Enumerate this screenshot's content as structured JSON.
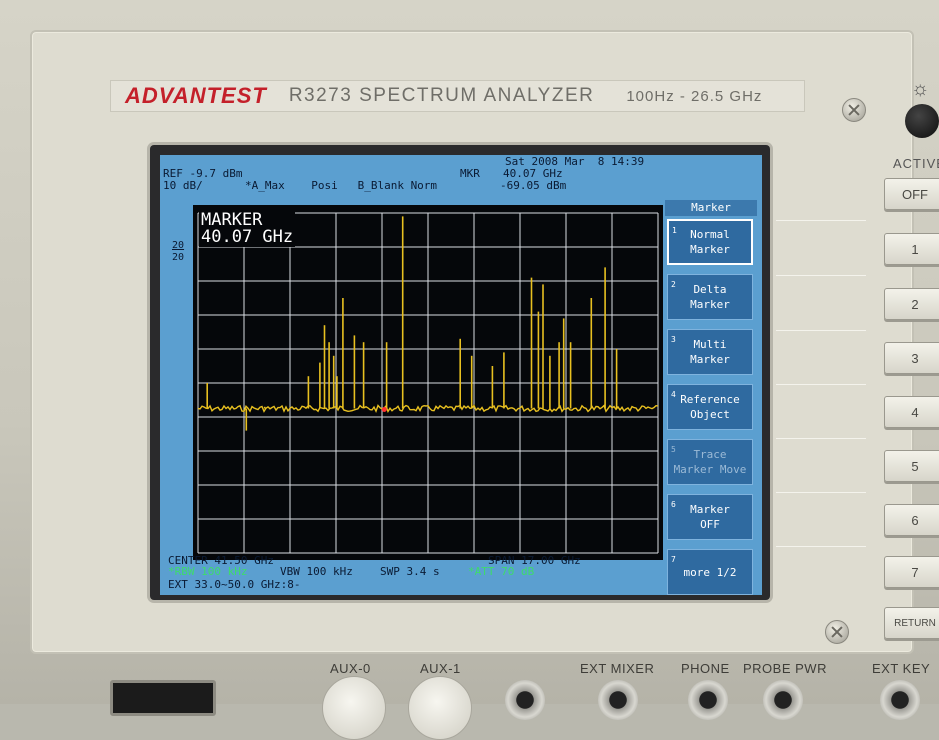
{
  "instrument": {
    "brand": "ADVANTEST",
    "model": "R3273  SPECTRUM  ANALYZER",
    "freq_range": "100Hz - 26.5 GHz"
  },
  "screen": {
    "datetime": "Sat 2008 Mar  8 14:39",
    "ref": "REF -9.7 dBm",
    "scale": "10 dB/",
    "trace_modes": "*A_Max    Posi   B_Blank Norm",
    "mkr_label": "MKR",
    "mkr_freq": "40.07 GHz",
    "mkr_level": "-69.05 dBm",
    "left_mark_top": "20",
    "left_mark_bottom": "20",
    "marker_readout_line1": "MARKER",
    "marker_readout_line2": "40.07 GHz",
    "center": "CENTER 41.50 GHz",
    "span": "SPAN 17.00 GHz",
    "rbw": "*RBW 100 kHz",
    "vbw": "VBW 100 kHz",
    "swp": "SWP 3.4 s",
    "att": "*ATT 70 dB",
    "ext": "EXT 33.0~50.0 GHz:8-"
  },
  "softkeys": {
    "title": "Marker",
    "keys": [
      {
        "num": "1",
        "line1": "Normal",
        "line2": "Marker"
      },
      {
        "num": "2",
        "line1": "Delta",
        "line2": "Marker"
      },
      {
        "num": "3",
        "line1": "Multi",
        "line2": "Marker"
      },
      {
        "num": "4",
        "line1": "Reference",
        "line2": "Object"
      },
      {
        "num": "5",
        "line1": "Trace",
        "line2": "Marker Move"
      },
      {
        "num": "6",
        "line1": "Marker",
        "line2": "OFF"
      },
      {
        "num": "7",
        "line1": "more 1/2",
        "line2": ""
      }
    ]
  },
  "side_buttons": {
    "active_label": "ACTIVE",
    "off": "OFF",
    "b1": "1",
    "b2": "2",
    "b3": "3",
    "b4": "4",
    "b5": "5",
    "b6": "6",
    "b7": "7",
    "return": "RETURN"
  },
  "bottom_labels": {
    "aux0": "AUX-0",
    "aux1": "AUX-1",
    "ext_mixer": "EXT MIXER",
    "phone": "PHONE",
    "probe_pwr": "PROBE PWR",
    "ext_key": "EXT KEY"
  },
  "trace": {
    "color": "#e8c020",
    "noise_floor": 0.575,
    "marker_position": 0.405,
    "spikes": [
      {
        "x": 0.02,
        "h": 0.5
      },
      {
        "x": 0.105,
        "h": 0.36
      },
      {
        "x": 0.145,
        "h": 0.43
      },
      {
        "x": 0.24,
        "h": 0.52
      },
      {
        "x": 0.265,
        "h": 0.56
      },
      {
        "x": 0.275,
        "h": 0.67
      },
      {
        "x": 0.285,
        "h": 0.62
      },
      {
        "x": 0.295,
        "h": 0.58
      },
      {
        "x": 0.302,
        "h": 0.52
      },
      {
        "x": 0.315,
        "h": 0.75
      },
      {
        "x": 0.34,
        "h": 0.64
      },
      {
        "x": 0.36,
        "h": 0.62
      },
      {
        "x": 0.41,
        "h": 0.62
      },
      {
        "x": 0.445,
        "h": 0.99
      },
      {
        "x": 0.57,
        "h": 0.63
      },
      {
        "x": 0.595,
        "h": 0.58
      },
      {
        "x": 0.64,
        "h": 0.55
      },
      {
        "x": 0.665,
        "h": 0.59
      },
      {
        "x": 0.725,
        "h": 0.81
      },
      {
        "x": 0.74,
        "h": 0.71
      },
      {
        "x": 0.75,
        "h": 0.79
      },
      {
        "x": 0.765,
        "h": 0.58
      },
      {
        "x": 0.785,
        "h": 0.62
      },
      {
        "x": 0.795,
        "h": 0.69
      },
      {
        "x": 0.81,
        "h": 0.62
      },
      {
        "x": 0.855,
        "h": 0.75
      },
      {
        "x": 0.885,
        "h": 0.84
      },
      {
        "x": 0.91,
        "h": 0.6
      }
    ]
  }
}
